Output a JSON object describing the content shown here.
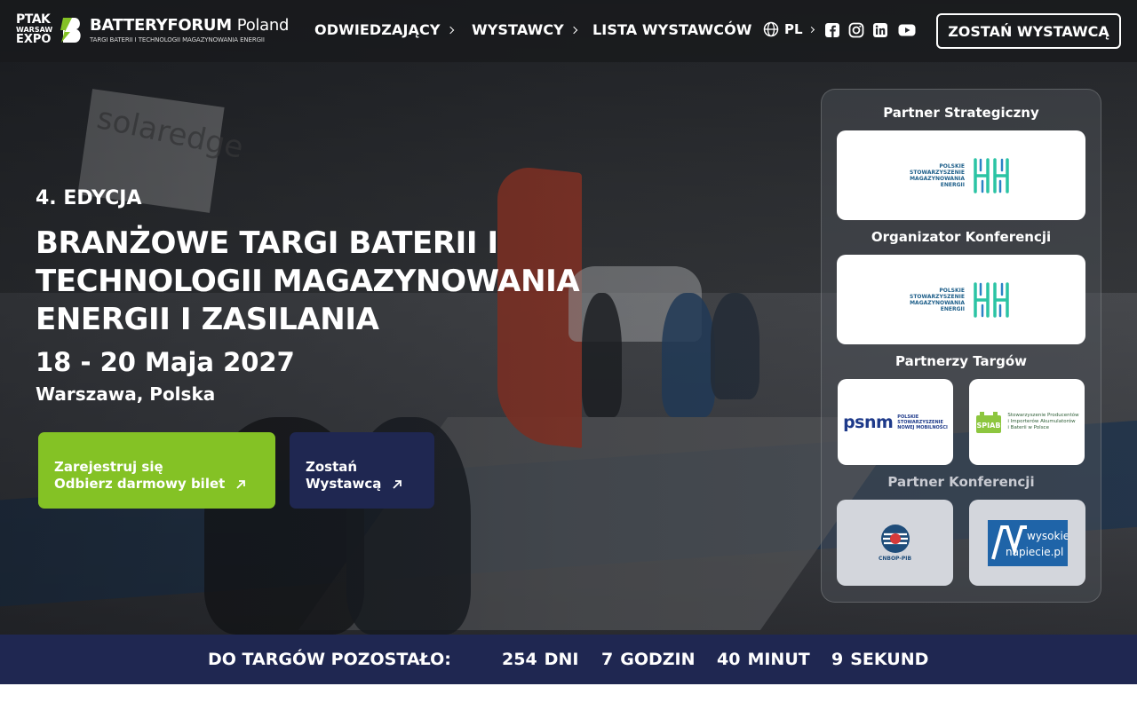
{
  "header": {
    "logo_ptak": [
      "PTAK",
      "WARSAW",
      "EXPO"
    ],
    "brand_bold": "BATTERYFORUM",
    "brand_light": "Poland",
    "brand_sub": "TARGI BATERII I TECHNOLOGII MAGAZYNOWANIA ENERGII",
    "nav": [
      {
        "label": "ODWIEDZAJĄCY",
        "has_chevron": true
      },
      {
        "label": "WYSTAWCY",
        "has_chevron": true
      },
      {
        "label": "LISTA WYSTAWCÓW",
        "has_chevron": false
      }
    ],
    "language": "PL",
    "social_icons": [
      "facebook-icon",
      "instagram-icon",
      "linkedin-icon",
      "youtube-icon"
    ],
    "cta_label": "ZOSTAŃ WYSTAWCĄ"
  },
  "hero": {
    "edition": "4. EDYCJA",
    "headline_lines": [
      "BRANŻOWE TARGI BATERII I",
      "TECHNOLOGII MAGAZYNOWANIA",
      "ENERGII I ZASILANIA"
    ],
    "dates": "18 - 20 Maja 2027",
    "location": "Warszawa, Polska",
    "background_text": "solaredge",
    "button_register": {
      "line1": "Zarejestruj się",
      "line2": "Odbierz darmowy bilet"
    },
    "button_exhibitor": {
      "line1": "Zostań",
      "line2": "Wystawcą"
    }
  },
  "partners": {
    "strategic_title": "Partner Strategiczny",
    "organizer_title": "Organizator Konferencji",
    "fair_partners_title": "Partnerzy Targów",
    "conference_partner_title": "Partner Konferencji",
    "pse_lines": [
      "POLSKIE",
      "STOWARZYSZENIE",
      "MAGAZYNOWANIA",
      "ENERGII"
    ],
    "psnm_word": "psnm",
    "psnm_lines": [
      "POLSKIE",
      "STOWARZYSZENIE",
      "NOWEJ MOBILNOŚCI"
    ],
    "spiab_word": "SPIAB",
    "spiab_lines": [
      "Stowarzyszenie Producentów",
      "i Importerów Akumulatorów",
      "i Baterii w Polsce"
    ],
    "cnbop_label": "CNBOP-PIB",
    "wysokie_line1": "wysokie",
    "wysokie_line2": "napiecie.pl"
  },
  "countdown": {
    "label": "DO TARGÓW POZOSTAŁO:",
    "days": {
      "value": "254",
      "unit": "DNI"
    },
    "hours": {
      "value": "7",
      "unit": "GODZIN"
    },
    "minutes": {
      "value": "40",
      "unit": "MINUT"
    },
    "seconds": {
      "value": "9",
      "unit": "SEKUND"
    }
  },
  "colors": {
    "navy": "#1f2751",
    "green": "#84c225",
    "white": "#ffffff"
  }
}
